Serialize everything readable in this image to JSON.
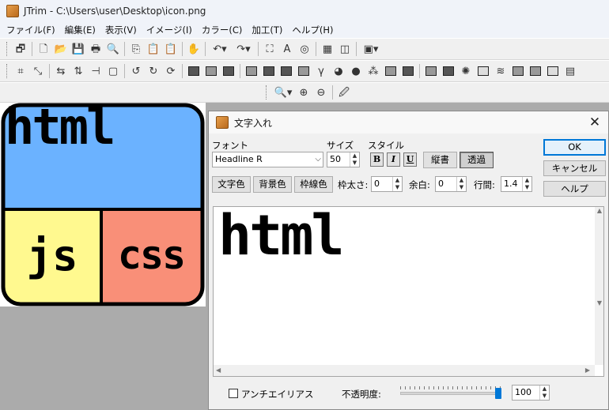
{
  "window": {
    "title": "JTrim - C:\\Users\\user\\Desktop\\icon.png"
  },
  "menubar": [
    "ファイル(F)",
    "編集(E)",
    "表示(V)",
    "イメージ(I)",
    "カラー(C)",
    "加工(T)",
    "ヘルプ(H)"
  ],
  "canvas": {
    "top_text": "html",
    "left_text": "js",
    "right_text": "css",
    "colors": {
      "top": "#6bb2ff",
      "left": "#fff98f",
      "right": "#f98f78",
      "border": "#000000"
    }
  },
  "dialog": {
    "title": "文字入れ",
    "font_label": "フォント",
    "font_value": "Headline R",
    "size_label": "サイズ",
    "size_value": "50",
    "style_label": "スタイル",
    "bold": "B",
    "italic": "I",
    "underline": "U",
    "vertical_btn": "縦書",
    "transparent_btn": "透過",
    "ok": "OK",
    "cancel": "キャンセル",
    "help": "ヘルプ",
    "text_color_btn": "文字色",
    "bg_color_btn": "背景色",
    "border_color_btn": "枠線色",
    "border_width_label": "枠太さ:",
    "border_width_value": "0",
    "margin_label": "余白:",
    "margin_value": "0",
    "line_spacing_label": "行間:",
    "line_spacing_value": "1.4",
    "preview_text": "html",
    "antialias_label": "アンチエイリアス",
    "antialias_checked": false,
    "opacity_label": "不透明度:",
    "opacity_value": "100",
    "opacity_fraction": 1.0
  },
  "icons": [
    "app-icon",
    "new-icon",
    "open-icon",
    "save-icon",
    "print-icon",
    "print-preview-icon",
    "copy-icon",
    "paste-icon",
    "undo-icon",
    "redo-icon",
    "zoom-icon",
    "zoom-in-icon",
    "zoom-out-icon",
    "eyedropper-icon",
    "close-icon"
  ]
}
